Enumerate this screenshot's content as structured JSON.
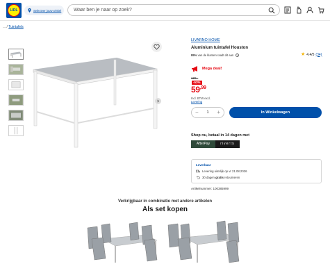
{
  "header": {
    "logo_text": "LIDL",
    "store_label": "Selecteer jouw winkel",
    "search_placeholder": "Waar ben je naar op zoek?",
    "icons": [
      "search-icon",
      "list-icon",
      "hand-icon",
      "user-icon",
      "cart-icon"
    ]
  },
  "breadcrumb": {
    "prefix": "... /",
    "link": "Tuintafels"
  },
  "gallery": {
    "thumb_count": 6
  },
  "product": {
    "brand": "LIVARNO HOME",
    "title": "Aluminium tuintafel Houston",
    "recommend_pct": "85%",
    "recommend_text": "van de klanten raadt dit aan",
    "rating": "4.4/5",
    "rating_count": "(34)",
    "deal_label": "Mega deal!",
    "old_price": "129.-",
    "discount": "-53%",
    "price_int": "59",
    "price_dec": ",99",
    "vat_text": "Incl. BTW excl.",
    "delivery_link": "Levering",
    "qty": "1",
    "qty_minus": "−",
    "qty_plus": "+",
    "cart_button": "In Winkelwagen"
  },
  "payment": {
    "heading": "Shop nu, betaal in 14 dagen met",
    "logo1": "AfterPay",
    "logo2": "riverty"
  },
  "delivery": {
    "heading": "Leverbaar",
    "line1": "Levering uiterlijk op vr 21.08.2026",
    "line2_pre": "30 dagen",
    "line2_bold": "gratis",
    "line2_post": "retourneren"
  },
  "article_number": "Artikelnummer: 100385999",
  "bottom": {
    "combo_text": "Verkrijgbaar in combinatie met andere artikelen",
    "set_heading": "Als set kopen"
  },
  "colors": {
    "brand_blue": "#0050aa",
    "deal_red": "#e60a14",
    "star": "#f5b301"
  }
}
